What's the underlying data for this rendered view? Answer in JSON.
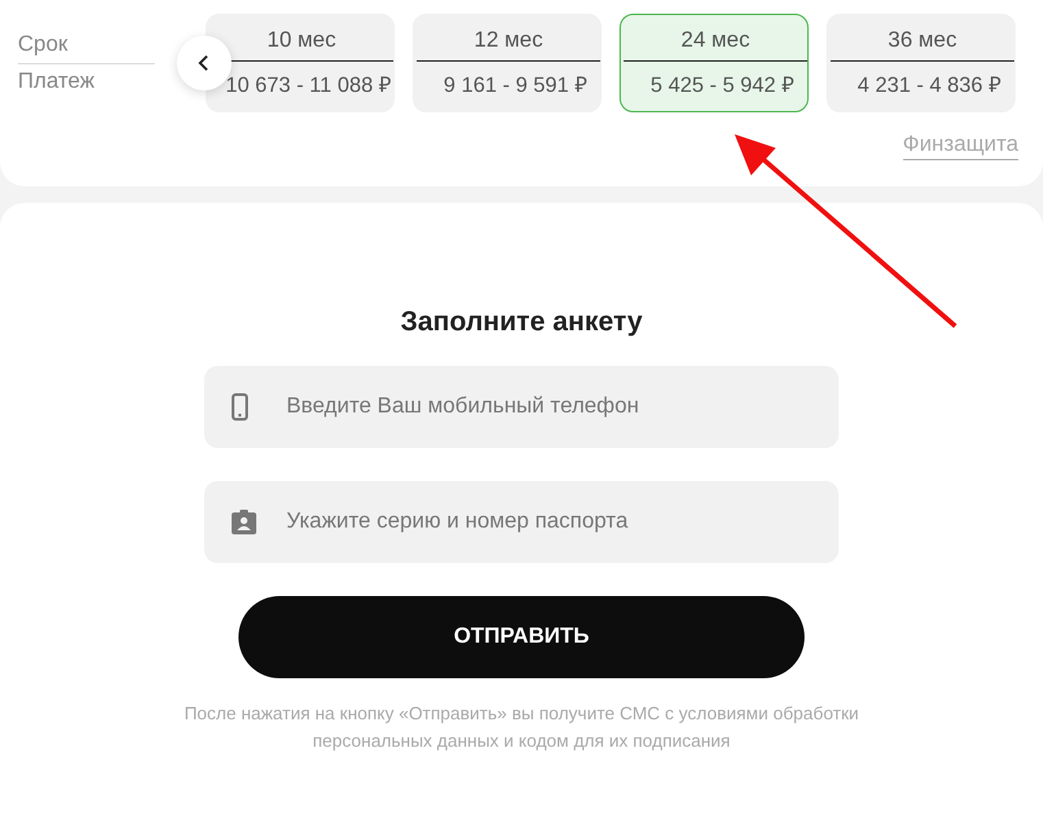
{
  "terms": {
    "term_label": "Срок",
    "payment_label": "Платеж",
    "options": [
      {
        "term": "10 мес",
        "payment": "10 673 - 11 088 ₽",
        "selected": false
      },
      {
        "term": "12 мес",
        "payment": "9 161 - 9 591 ₽",
        "selected": false
      },
      {
        "term": "24 мес",
        "payment": "5 425 - 5 942 ₽",
        "selected": true
      },
      {
        "term": "36 мес",
        "payment": "4 231 - 4 836 ₽",
        "selected": false
      }
    ],
    "insurance_link": "Финзащита"
  },
  "form": {
    "title": "Заполните анкету",
    "fields": [
      {
        "kind": "phone",
        "placeholder": "Введите Ваш мобильный телефон"
      },
      {
        "kind": "passport",
        "placeholder": "Укажите серию и номер паспорта"
      }
    ],
    "submit": "ОТПРАВИТЬ",
    "note": "После нажатия на кнопку «Отправить» вы получите СМС с условиями обработки персональных данных и кодом для их подписания"
  }
}
